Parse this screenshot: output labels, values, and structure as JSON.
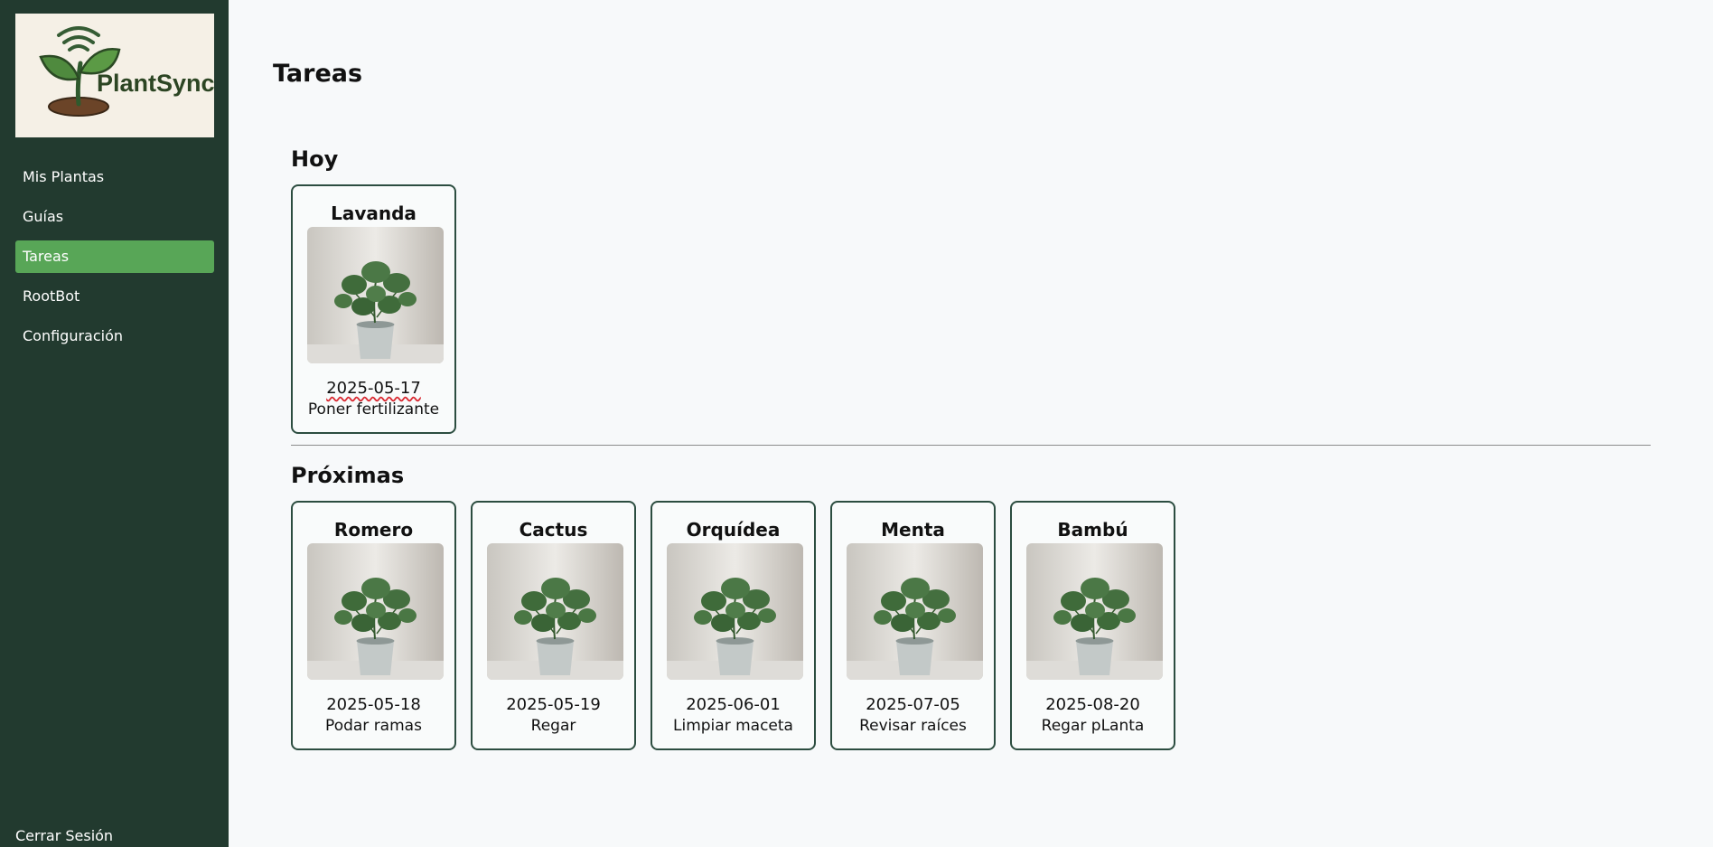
{
  "brand": {
    "name": "PlantSync"
  },
  "sidebar": {
    "items": [
      {
        "label": "Mis Plantas"
      },
      {
        "label": "Guías"
      },
      {
        "label": "Tareas"
      },
      {
        "label": "RootBot"
      },
      {
        "label": "Configuración"
      }
    ],
    "active": "Tareas",
    "logout_label": "Cerrar Sesión"
  },
  "page": {
    "title": "Tareas"
  },
  "today": {
    "title": "Hoy",
    "tasks": [
      {
        "plant": "Lavanda",
        "date": "2025-05-17",
        "task": "Poner fertilizante"
      }
    ]
  },
  "upcoming": {
    "title": "Próximas",
    "tasks": [
      {
        "plant": "Romero",
        "date": "2025-05-18",
        "task": "Podar ramas"
      },
      {
        "plant": "Cactus",
        "date": "2025-05-19",
        "task": "Regar"
      },
      {
        "plant": "Orquídea",
        "date": "2025-06-01",
        "task": "Limpiar maceta"
      },
      {
        "plant": "Menta",
        "date": "2025-07-05",
        "task": "Revisar raíces"
      },
      {
        "plant": "Bambú",
        "date": "2025-08-20",
        "task": "Regar pLanta"
      }
    ]
  },
  "colors": {
    "sidebar_bg": "#223a2f",
    "active_item": "#58a657",
    "card_border": "#2c4d40",
    "page_bg": "#f7f9fa"
  }
}
